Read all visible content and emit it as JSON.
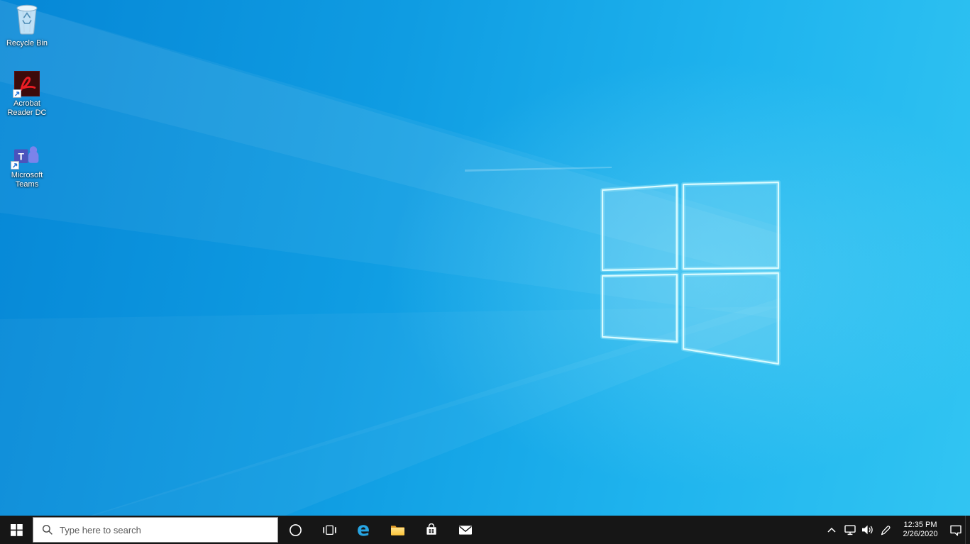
{
  "colors": {
    "taskbar_bg": "#161616",
    "wallpaper_blue_dark": "#0687d6",
    "wallpaper_blue_light": "#32c5f2",
    "logo_stroke_cyan": "#d9fbff",
    "edge_blue": "#27a5e3",
    "folder_yellow": "#fdc53a",
    "teams_tile_purple": "#4b53bc",
    "teams_person_purple": "#7b83eb",
    "acrobat_dark_red": "#3c0b0b",
    "acrobat_swirl_red": "#ec1c24"
  },
  "desktop": {
    "wallpaper": "windows-10-light-rays",
    "icons": [
      {
        "id": "recycle-bin",
        "icon": "recycle-bin-icon",
        "label": "Recycle Bin"
      },
      {
        "id": "acrobat-reader-dc",
        "icon": "acrobat-reader-icon",
        "label": "Acrobat Reader DC"
      },
      {
        "id": "microsoft-teams",
        "icon": "teams-icon",
        "label": "Microsoft Teams",
        "glyph": "T"
      }
    ]
  },
  "taskbar": {
    "start": {
      "icon": "windows-flag-icon"
    },
    "search_placeholder": "Type here to search",
    "search_icon": "search-icon",
    "edge_glyph": "e",
    "app_buttons": [
      {
        "id": "cortana",
        "icon": "cortana-circle-icon"
      },
      {
        "id": "task-view",
        "icon": "task-view-icon"
      },
      {
        "id": "microsoft-edge",
        "icon": "edge-icon"
      },
      {
        "id": "file-explorer",
        "icon": "folder-icon"
      },
      {
        "id": "microsoft-store",
        "icon": "store-bag-icon"
      },
      {
        "id": "mail",
        "icon": "mail-envelope-icon"
      }
    ],
    "tray": {
      "icons": [
        {
          "id": "show-hidden-icons",
          "icon": "chevron-up-icon"
        },
        {
          "id": "network",
          "icon": "network-icon"
        },
        {
          "id": "volume",
          "icon": "speaker-icon"
        },
        {
          "id": "windows-ink",
          "icon": "pen-icon"
        }
      ],
      "time": "12:35 PM",
      "date": "2/26/2020",
      "action_center_icon": "action-center-icon"
    }
  }
}
